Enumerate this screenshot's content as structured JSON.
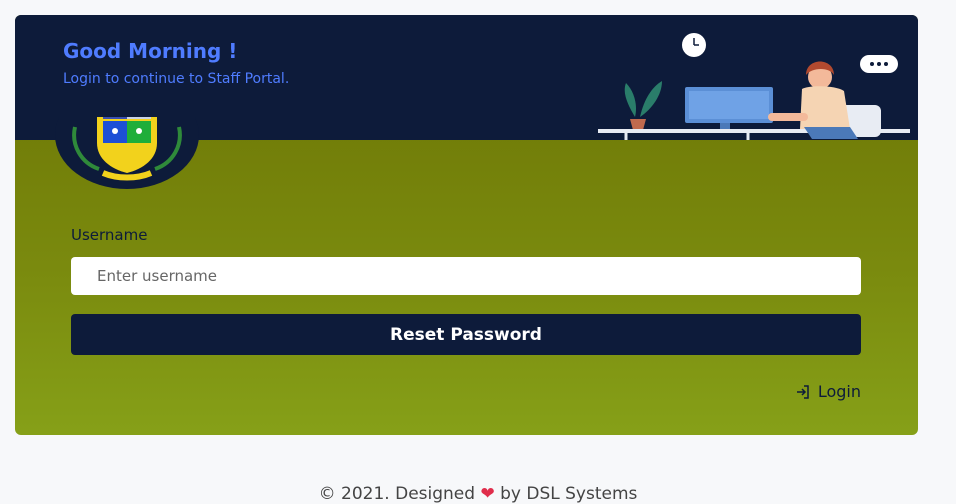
{
  "header": {
    "greeting": "Good Morning !",
    "subtext": "Login to continue to Staff Portal."
  },
  "logo": {
    "name": "institution-crest"
  },
  "form": {
    "username_label": "Username",
    "username_placeholder": "Enter username",
    "username_value": "",
    "submit_label": "Reset Password"
  },
  "links": {
    "login_label": "Login",
    "login_icon": "login-icon"
  },
  "footer": {
    "prefix": "© 2021. Designed",
    "suffix": "by DSL Systems",
    "heart_icon": "heart-icon"
  },
  "colors": {
    "header_bg": "#0d1b3a",
    "accent_blue": "#4f7cff",
    "card_olive": "#7a8a0e",
    "button_bg": "#0d1b3a",
    "heart": "#e02d4b"
  }
}
